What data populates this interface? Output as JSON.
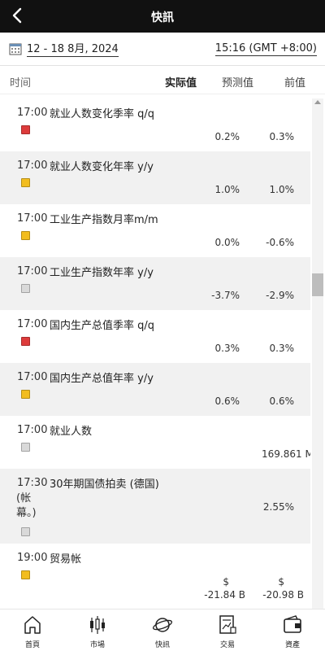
{
  "header": {
    "title": "快訊",
    "back_icon": "chevron-left-icon"
  },
  "datebar": {
    "range": "12 - 18 8月, 2024",
    "timezone": "15:16 (GMT +8:00)",
    "calendar_icon": "calendar-icon"
  },
  "columns": {
    "time": "时间",
    "actual": "实际值",
    "forecast": "预测值",
    "previous": "前值"
  },
  "importance_colors": {
    "high": "#dd3b3b",
    "medium": "#f2bd1f",
    "low": "#d9d9d9"
  },
  "events": [
    {
      "time": "17:00",
      "name": "就业人数变化季率 q/q",
      "importance": "high",
      "actual": "",
      "forecast": "0.2%",
      "previous": "0.3%"
    },
    {
      "time": "17:00",
      "name": "就业人数变化年率 y/y",
      "importance": "medium",
      "actual": "",
      "forecast": "1.0%",
      "previous": "1.0%"
    },
    {
      "time": "17:00",
      "name": "工业生产指数月率m/m",
      "importance": "medium",
      "actual": "",
      "forecast": "0.0%",
      "previous": "-0.6%"
    },
    {
      "time": "17:00",
      "name": "工业生产指数年率 y/y",
      "importance": "low",
      "actual": "",
      "forecast": "-3.7%",
      "previous": "-2.9%"
    },
    {
      "time": "17:00",
      "name": "国内生产总值季率 q/q",
      "importance": "high",
      "actual": "",
      "forecast": "0.3%",
      "previous": "0.3%"
    },
    {
      "time": "17:00",
      "name": "国内生产总值年率 y/y",
      "importance": "medium",
      "actual": "",
      "forecast": "0.6%",
      "previous": "0.6%"
    },
    {
      "time": "17:00",
      "name": "就业人数",
      "importance": "low",
      "actual": "",
      "forecast": "",
      "previous": "169.861 M"
    },
    {
      "time": "17:30",
      "name": "30年期国债拍卖 (德国)",
      "name_extra": "(帐幕。)",
      "importance": "low",
      "actual": "",
      "forecast": "",
      "previous": "2.55%"
    },
    {
      "time": "19:00",
      "name": "贸易帐",
      "importance": "medium",
      "actual": "",
      "forecast_currency": "$",
      "forecast": "-21.84 B",
      "previous_currency": "$",
      "previous": "-20.98 B"
    }
  ],
  "bottom_nav": [
    {
      "label": "首頁",
      "icon": "home-icon"
    },
    {
      "label": "市場",
      "icon": "candlestick-icon"
    },
    {
      "label": "快訊",
      "icon": "planet-icon"
    },
    {
      "label": "交易",
      "icon": "trade-document-icon"
    },
    {
      "label": "資產",
      "icon": "wallet-icon"
    }
  ]
}
